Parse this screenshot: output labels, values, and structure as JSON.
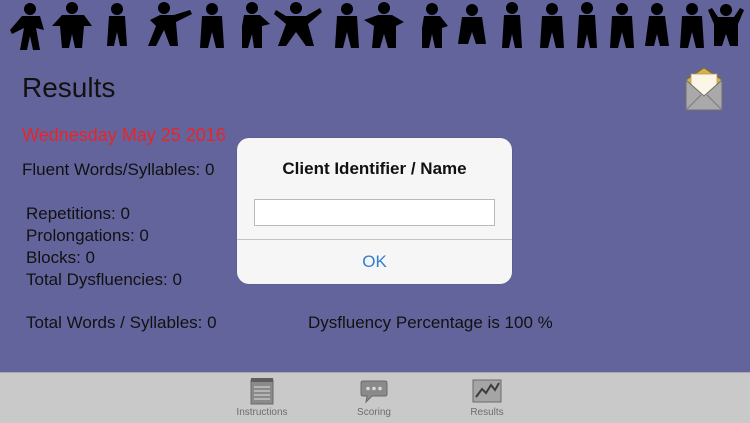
{
  "screen": {
    "title": "Results",
    "date": "Wednesday May 25 2016",
    "fluent_words": "Fluent Words/Syllables: 0",
    "repetitions": "Repetitions: 0",
    "prolongations": "Prolongations: 0",
    "blocks": "Blocks: 0",
    "total_dysfluencies": "Total Dysfluencies: 0",
    "total_words": "Total Words / Syllables: 0",
    "dysfluency_percentage": "Dysfluency Percentage is 100 %"
  },
  "dialog": {
    "title": "Client Identifier / Name",
    "input_value": "",
    "ok_label": "OK"
  },
  "tabbar": {
    "tabs": [
      {
        "label": "Instructions",
        "icon": "notepad-icon"
      },
      {
        "label": "Scoring",
        "icon": "speech-bubble-icon"
      },
      {
        "label": "Results",
        "icon": "chart-icon"
      }
    ],
    "selected": "Results"
  },
  "colors": {
    "background": "#64649c",
    "date_red": "#e8242a",
    "link_blue": "#2f7fd0",
    "tabbar": "#c9c9c9"
  }
}
